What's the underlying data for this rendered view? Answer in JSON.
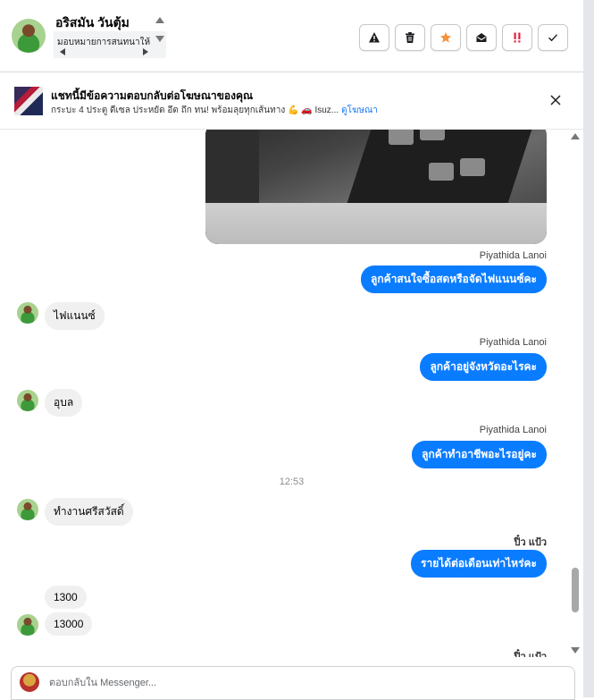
{
  "header": {
    "contact_name": "อริสมัน วันตุ้ม",
    "assign_label": "มอบหมายการสนทนาให้"
  },
  "actions": [
    {
      "name": "spam-button",
      "icon": "warning-icon"
    },
    {
      "name": "delete-button",
      "icon": "trash-icon"
    },
    {
      "name": "star-button",
      "icon": "star-icon",
      "color": "#f7923a"
    },
    {
      "name": "mark-unread-button",
      "icon": "envelope-open-icon"
    },
    {
      "name": "follow-up-button",
      "icon": "double-exclamation-icon",
      "color": "#e41e3f"
    },
    {
      "name": "done-button",
      "icon": "checkmark-icon"
    }
  ],
  "ad": {
    "title": "แชทนี้มีข้อความตอบกลับต่อโฆษณาของคุณ",
    "body": "กระบะ 4 ประตู ดีเซล ประหยัด อึด ถึก ทน! พร้อมลุยทุกเส้นทาง 💪 🚗 Isuz...",
    "link": "ดูโฆษณา"
  },
  "messages": {
    "sender_1": "Piyathida Lanoi",
    "out_1": "ลูกค้าสนใจซื้อสดหรือจัดไฟแนนซ์คะ",
    "in_1": "ไฟแนนซ์",
    "sender_2": "Piyathida Lanoi",
    "out_2": "ลูกค้าอยู่จังหวัดอะไรคะ",
    "in_2": "อุบล",
    "sender_3": "Piyathida Lanoi",
    "out_3": "ลูกค้าทำอาชีพอะไรอยู่คะ",
    "timestamp": "12:53",
    "in_3": "ทำงานศรีสวัสดิ์",
    "sender_4": "ปิ๋ว แป้ว",
    "out_4": "รายได้ต่อเดือนเท่าไหร่คะ",
    "in_4a": "1300",
    "in_4b": "13000",
    "sender_5": "ปิ๋ว แป้ว"
  },
  "composer": {
    "placeholder": "ตอบกลับใน Messenger..."
  }
}
